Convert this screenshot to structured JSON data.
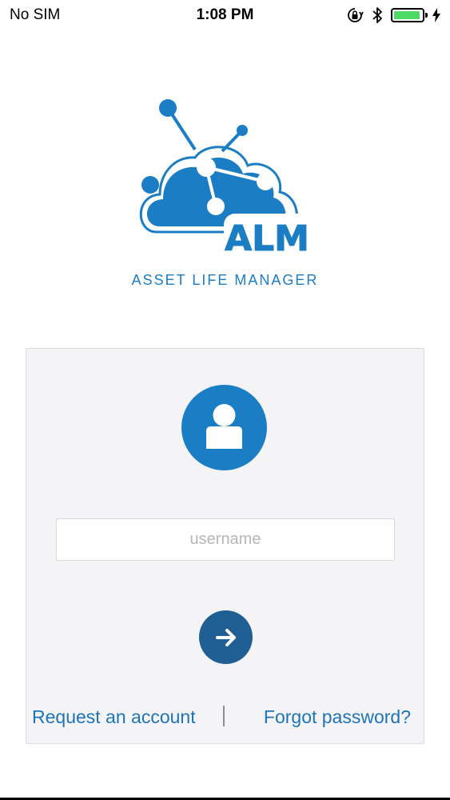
{
  "status_bar": {
    "carrier": "No SIM",
    "time": "1:08 PM",
    "battery_level": 0.95,
    "icons": [
      "orientation-lock-icon",
      "bluetooth-icon",
      "battery-icon",
      "charging-icon"
    ]
  },
  "logo": {
    "brand": "ALM",
    "caption": "ASSET LIFE MANAGER",
    "color": "#1b7dc4"
  },
  "login": {
    "avatar_icon": "user-icon",
    "username_placeholder": "username",
    "username_value": "",
    "submit_icon": "arrow-right-icon",
    "request_account": "Request an account",
    "forgot_password": "Forgot password?"
  },
  "colors": {
    "primary": "#1b7dc4",
    "button": "#1f5f93",
    "link": "#1f74b8",
    "card_bg": "#f4f4f6"
  }
}
